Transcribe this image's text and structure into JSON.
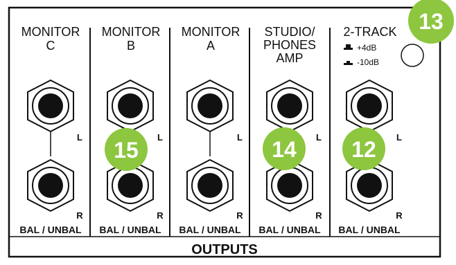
{
  "panel": {
    "footer_label": "OUTPUTS",
    "columns": [
      {
        "id": "monitor-c",
        "title_lines": [
          "MONITOR",
          "C"
        ],
        "jack_left_label": "L",
        "jack_right_label": "R",
        "bal_label": "BAL / UNBAL"
      },
      {
        "id": "monitor-b",
        "title_lines": [
          "MONITOR",
          "B"
        ],
        "jack_left_label": "L",
        "jack_right_label": "R",
        "bal_label": "BAL / UNBAL"
      },
      {
        "id": "monitor-a",
        "title_lines": [
          "MONITOR",
          "A"
        ],
        "jack_left_label": "L",
        "jack_right_label": "R",
        "bal_label": "BAL / UNBAL"
      },
      {
        "id": "studio-phones-amp",
        "title_lines": [
          "STUDIO/",
          "PHONES",
          "AMP"
        ],
        "jack_left_label": "L",
        "jack_right_label": "R",
        "bal_label": "BAL / UNBAL"
      },
      {
        "id": "two-track",
        "title_lines": [
          "2-TRACK"
        ],
        "jack_left_label": "L",
        "jack_right_label": "R",
        "bal_label": "BAL / UNBAL"
      }
    ],
    "level_switch": {
      "high_label": "+4dB",
      "low_label": "-10dB"
    }
  },
  "callouts": [
    {
      "number": "13",
      "target": "level-switch"
    },
    {
      "number": "15",
      "target": "monitor-b"
    },
    {
      "number": "14",
      "target": "studio-phones-amp"
    },
    {
      "number": "12",
      "target": "two-track"
    }
  ],
  "colors": {
    "badge": "#8dc63f",
    "line": "#111111",
    "background": "#ffffff"
  }
}
